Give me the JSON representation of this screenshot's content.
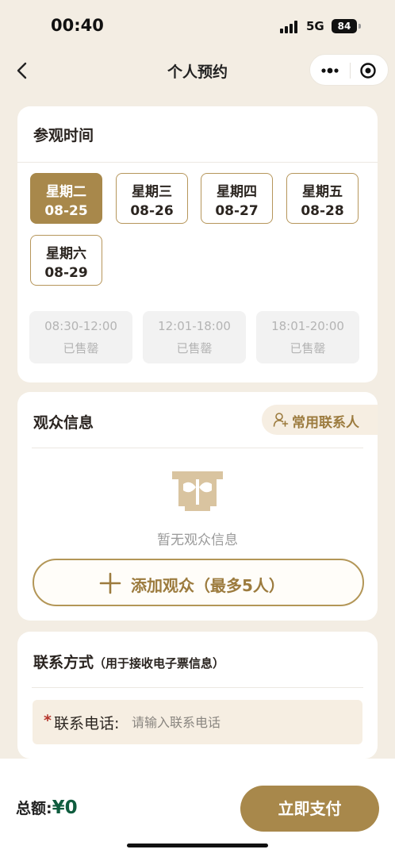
{
  "status_bar": {
    "time": "00:40",
    "network": "5G",
    "battery": "84"
  },
  "nav": {
    "title": "个人预约"
  },
  "visit_time": {
    "title": "参观时间",
    "dates": [
      {
        "weekday": "星期二",
        "date": "08-25",
        "selected": true
      },
      {
        "weekday": "星期三",
        "date": "08-26",
        "selected": false
      },
      {
        "weekday": "星期四",
        "date": "08-27",
        "selected": false
      },
      {
        "weekday": "星期五",
        "date": "08-28",
        "selected": false
      },
      {
        "weekday": "星期六",
        "date": "08-29",
        "selected": false
      }
    ],
    "slots": [
      {
        "time": "08:30-12:00",
        "status": "已售罄"
      },
      {
        "time": "12:01-18:00",
        "status": "已售罄"
      },
      {
        "time": "18:01-20:00",
        "status": "已售罄"
      }
    ]
  },
  "audience": {
    "title": "观众信息",
    "contacts_button": "常用联系人",
    "empty_text": "暂无观众信息",
    "add_button": "添加观众（最多5人）"
  },
  "contact": {
    "title": "联系方式",
    "subtitle": "（用于接收电子票信息）",
    "phone_required_mark": "*",
    "phone_label": "联系电话:",
    "phone_placeholder": "请输入联系电话",
    "phone_value": ""
  },
  "footer": {
    "total_label": "总额:",
    "total_amount": "¥0",
    "pay_button": "立即支付"
  },
  "colors": {
    "accent": "#a8884b",
    "background": "#f3ede3",
    "amount": "#0f5c3e",
    "disabled_text": "#b4b4b4"
  }
}
